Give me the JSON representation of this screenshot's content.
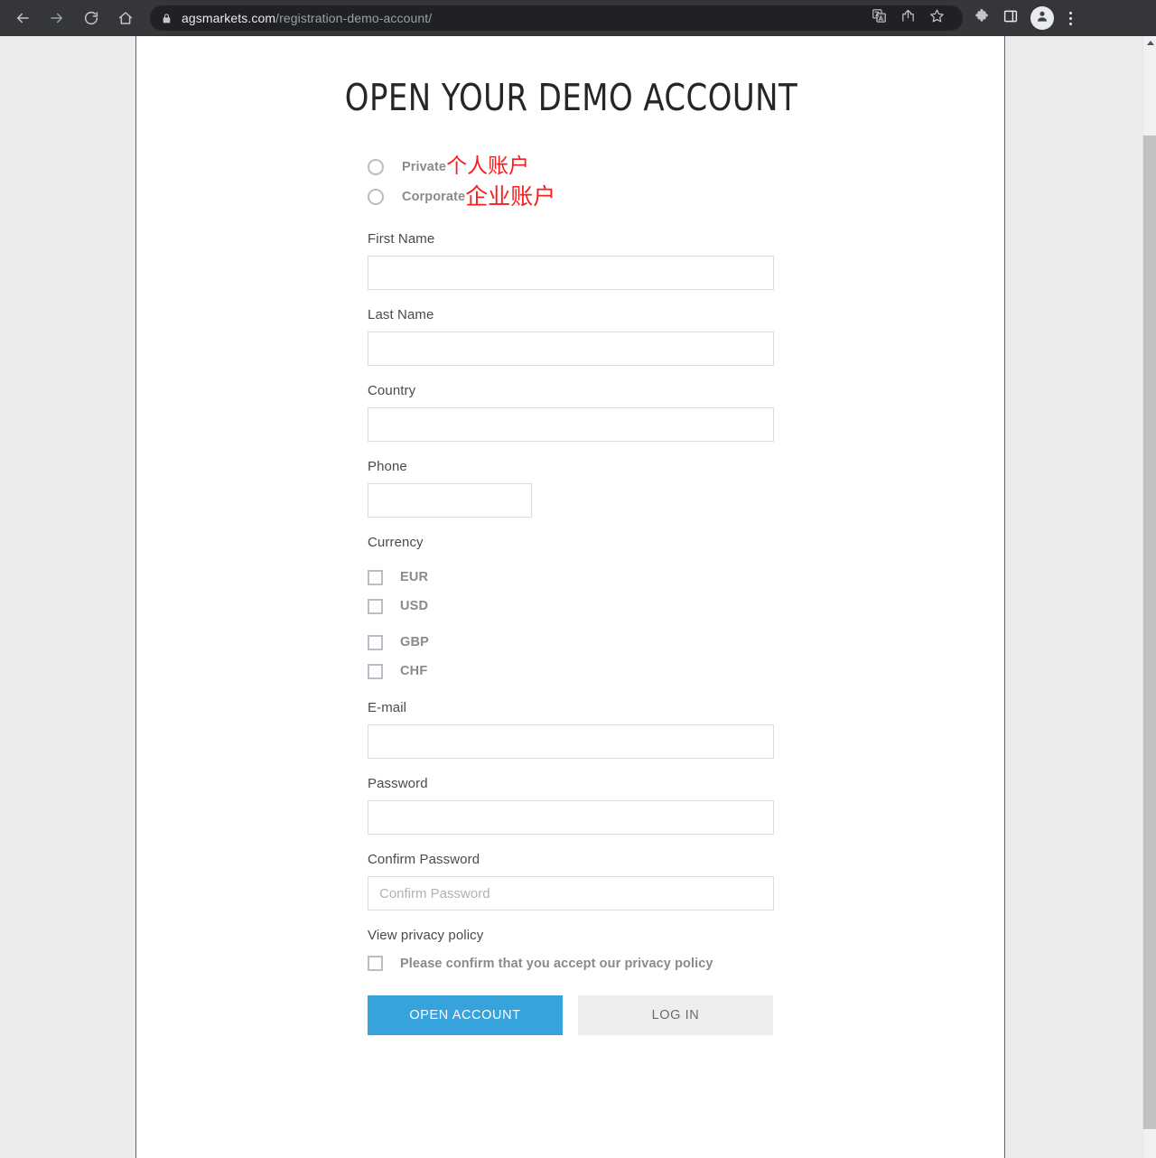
{
  "browser": {
    "back_icon": "back-arrow-icon",
    "forward_icon": "forward-arrow-icon",
    "reload_icon": "reload-icon",
    "home_icon": "home-icon",
    "lock_icon": "lock-icon",
    "url_domain": "agsmarkets.com",
    "url_path": "/registration-demo-account/",
    "translate_icon": "translate-icon",
    "share_icon": "share-icon",
    "bookmark_icon": "bookmark-star-icon",
    "extensions_icon": "puzzle-piece-icon",
    "side_panel_icon": "side-panel-icon",
    "profile_icon": "profile-avatar-icon",
    "menu_icon": "three-dot-menu-icon"
  },
  "page": {
    "title": "OPEN YOUR DEMO ACCOUNT",
    "account_type": {
      "options": [
        {
          "label": "Private",
          "annotation": "个人账户",
          "checked": false
        },
        {
          "label": "Corporate",
          "annotation": "企业账户",
          "checked": false
        }
      ]
    },
    "fields": [
      {
        "label": "First Name",
        "value": "",
        "placeholder": ""
      },
      {
        "label": "Last Name",
        "value": "",
        "placeholder": ""
      },
      {
        "label": "Country",
        "value": "",
        "placeholder": ""
      },
      {
        "label": "Phone",
        "value": "",
        "placeholder": ""
      }
    ],
    "currency": {
      "label": "Currency",
      "options": [
        {
          "label": "EUR",
          "checked": false
        },
        {
          "label": "USD",
          "checked": false
        },
        {
          "label": "GBP",
          "checked": false
        },
        {
          "label": "CHF",
          "checked": false
        }
      ]
    },
    "credentials": [
      {
        "label": "E-mail",
        "value": "",
        "placeholder": ""
      },
      {
        "label": "Password",
        "value": "",
        "placeholder": ""
      },
      {
        "label": "Confirm Password",
        "value": "",
        "placeholder": "Confirm Password"
      }
    ],
    "privacy": {
      "link_text": "View privacy policy",
      "consent_text": "Please confirm that you accept our privacy policy",
      "checked": false
    },
    "buttons": {
      "primary": "OPEN ACCOUNT",
      "secondary": "LOG IN"
    }
  },
  "colors": {
    "accent": "#36a3dd",
    "annotation_red": "#fa1d1d",
    "label_gray": "#4a4a4a",
    "bold_label_gray": "#8a8a8a",
    "input_border": "#dcdcdc",
    "chrome_bg": "#35363a",
    "omnibox_bg": "#202124",
    "secondary_btn_bg": "#eeeeee"
  }
}
